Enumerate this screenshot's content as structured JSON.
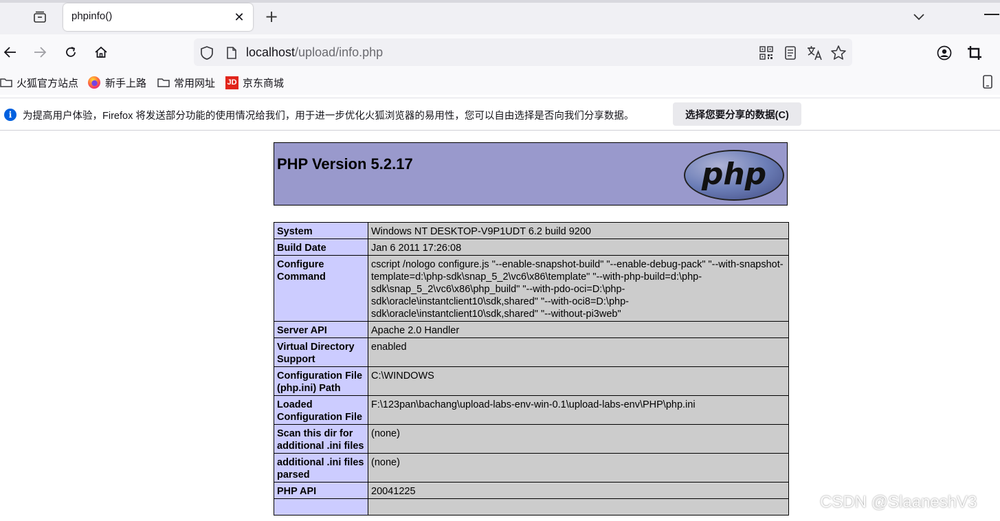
{
  "tab": {
    "title": "phpinfo()",
    "close_glyph": "✕",
    "new_tab_glyph": "+"
  },
  "url": {
    "host": "localhost",
    "path": "/upload/info.php"
  },
  "bookmarks": [
    {
      "label": "火狐官方站点",
      "icon": "folder-icon"
    },
    {
      "label": "新手上路",
      "icon": "firefox-icon"
    },
    {
      "label": "常用网址",
      "icon": "folder-icon"
    },
    {
      "label": "京东商城",
      "icon": "jd-icon",
      "badge": "JD"
    }
  ],
  "notification": {
    "icon_glyph": "i",
    "text": "为提高用户体验，Firefox 将发送部分功能的使用情况给我们，用于进一步优化火狐浏览器的易用性，您可以自由选择是否向我们分享数据。",
    "button_label": "选择您要分享的数据(C)"
  },
  "php": {
    "version_title": "PHP Version 5.2.17",
    "logo_text": "php",
    "rows": [
      {
        "key": "System",
        "value": "Windows NT DESKTOP-V9P1UDT 6.2 build 9200"
      },
      {
        "key": "Build Date",
        "value": "Jan 6 2011 17:26:08"
      },
      {
        "key": "Configure Command",
        "value": "cscript /nologo configure.js \"--enable-snapshot-build\" \"--enable-debug-pack\" \"--with-snapshot-template=d:\\php-sdk\\snap_5_2\\vc6\\x86\\template\" \"--with-php-build=d:\\php-sdk\\snap_5_2\\vc6\\x86\\php_build\" \"--with-pdo-oci=D:\\php-sdk\\oracle\\instantclient10\\sdk,shared\" \"--with-oci8=D:\\php-sdk\\oracle\\instantclient10\\sdk,shared\" \"--without-pi3web\""
      },
      {
        "key": "Server API",
        "value": "Apache 2.0 Handler"
      },
      {
        "key": "Virtual Directory Support",
        "value": "enabled"
      },
      {
        "key": "Configuration File (php.ini) Path",
        "value": "C:\\WINDOWS"
      },
      {
        "key": "Loaded Configuration File",
        "value": "F:\\123pan\\bachang\\upload-labs-env-win-0.1\\upload-labs-env\\PHP\\php.ini"
      },
      {
        "key": "Scan this dir for additional .ini files",
        "value": "(none)"
      },
      {
        "key": "additional .ini files parsed",
        "value": "(none)"
      },
      {
        "key": "PHP API",
        "value": "20041225"
      },
      {
        "key": "",
        "value": ""
      }
    ]
  },
  "watermark": "CSDN @SlaaneshV3",
  "colors": {
    "php_header_bg": "#9999cc",
    "php_key_bg": "#ccccff",
    "php_value_bg": "#cccccc",
    "info_blue": "#0060df",
    "jd_red": "#e1251b"
  }
}
